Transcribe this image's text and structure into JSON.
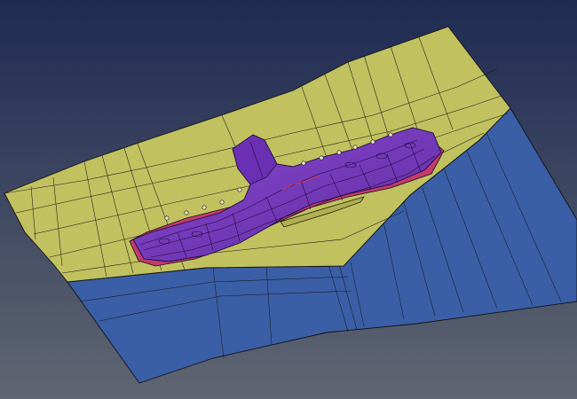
{
  "viewport": {
    "background_top": "#1f2a52",
    "background_bottom": "#606672"
  },
  "surfaces": {
    "binder": {
      "color": "#c1c160"
    },
    "blank_holder": {
      "color": "#3a5fa7"
    },
    "part": {
      "color": "#7a3cc0"
    },
    "flange": {
      "color": "#c23a6e"
    }
  }
}
